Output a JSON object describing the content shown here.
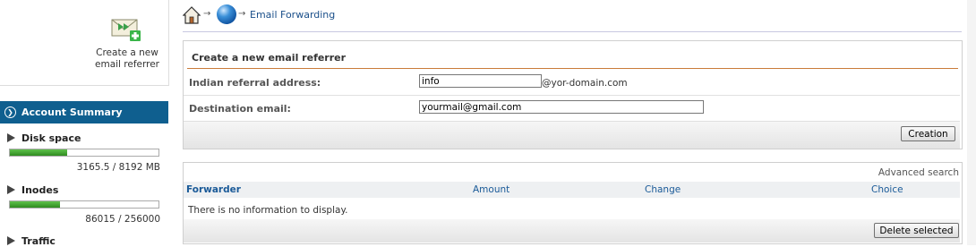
{
  "sidebar": {
    "new_referrer": {
      "label": "Create a new email referrer"
    },
    "account_summary": {
      "title": "Account Summary",
      "stats": [
        {
          "name": "Disk space",
          "value": "3165.5 / 8192 MB",
          "fraction": 0.386
        },
        {
          "name": "Inodes",
          "value": "86015 / 256000",
          "fraction": 0.336
        },
        {
          "name": "Traffic"
        }
      ]
    }
  },
  "breadcrumb": {
    "current": "Email Forwarding"
  },
  "create_form": {
    "title": "Create a new email referrer",
    "fields": [
      {
        "label": "Indian referral address:",
        "value": "info",
        "suffix": "@yor-domain.com"
      },
      {
        "label": "Destination email:",
        "value": "yourmail@gmail.com"
      }
    ],
    "submit_label": "Creation"
  },
  "forwarders": {
    "advanced_search": "Advanced search",
    "columns": [
      "Forwarder",
      "Amount",
      "Change",
      "Choice"
    ],
    "empty_message": "There is no information to display.",
    "delete_label": "Delete selected"
  },
  "colors": {
    "accent_header": "#0f5f8f",
    "link": "#1a5a98",
    "progress": "#2e8b1f",
    "form_rule": "#c97b3a"
  }
}
